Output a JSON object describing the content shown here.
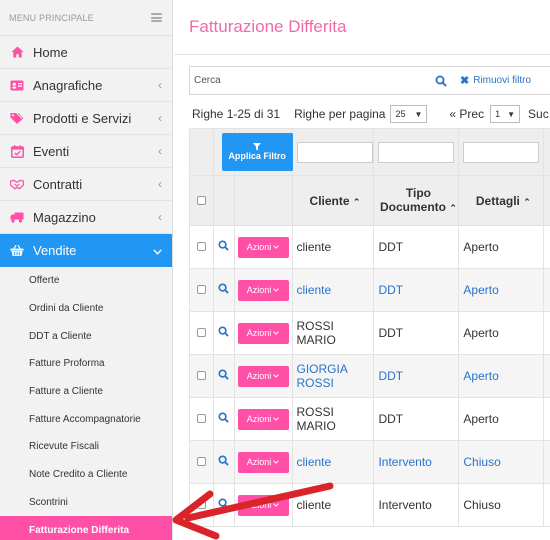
{
  "sidebar": {
    "title": "MENU PRINCIPALE",
    "items": [
      {
        "label": "Home",
        "icon": "home-icon",
        "has_chevron": false
      },
      {
        "label": "Anagrafiche",
        "icon": "id-card-icon",
        "has_chevron": true
      },
      {
        "label": "Prodotti e Servizi",
        "icon": "tags-icon",
        "has_chevron": true
      },
      {
        "label": "Eventi",
        "icon": "calendar-check-icon",
        "has_chevron": true
      },
      {
        "label": "Contratti",
        "icon": "handshake-icon",
        "has_chevron": true
      },
      {
        "label": "Magazzino",
        "icon": "truck-icon",
        "has_chevron": true
      },
      {
        "label": "Vendite",
        "icon": "basket-icon",
        "has_chevron": true,
        "active": true
      }
    ],
    "sub_items": [
      "Offerte",
      "Ordini da Cliente",
      "DDT a Cliente",
      "Fatture Proforma",
      "Fatture a Cliente",
      "Fatture Accompagnatorie",
      "Ricevute Fiscali",
      "Note Credito a Cliente",
      "Scontrini",
      "Fatturazione Differita"
    ],
    "active_sub_item": "Fatturazione Differita"
  },
  "main": {
    "title": "Fatturazione Differita",
    "search": {
      "placeholder": "Cerca",
      "remove_filters_label": "Rimuovi filtro"
    },
    "pager": {
      "rows_info": "Righe 1-25 di 31",
      "rows_per_page_label": "Righe per pagina",
      "rows_per_page_value": "25",
      "prev_label": "« Prec",
      "page_value": "1",
      "next_label": "Suc"
    },
    "apply_filter_label": "Applica Filtro",
    "columns": {
      "cliente": "Cliente",
      "tipo_documento": "Tipo Documento",
      "dettagli": "Dettagli"
    },
    "actions_label": "Azioni",
    "rows": [
      {
        "cliente": "cliente",
        "tipo": "DDT",
        "dettagli": "Aperto",
        "link": false
      },
      {
        "cliente": "cliente",
        "tipo": "DDT",
        "dettagli": "Aperto",
        "link": true
      },
      {
        "cliente": "ROSSI MARIO",
        "tipo": "DDT",
        "dettagli": "Aperto",
        "link": false
      },
      {
        "cliente": "GIORGIA ROSSI",
        "tipo": "DDT",
        "dettagli": "Aperto",
        "link": true
      },
      {
        "cliente": "ROSSI MARIO",
        "tipo": "DDT",
        "dettagli": "Aperto",
        "link": false
      },
      {
        "cliente": "cliente",
        "tipo": "Intervento",
        "dettagli": "Chiuso",
        "link": true
      },
      {
        "cliente": "cliente",
        "tipo": "Intervento",
        "dettagli": "Chiuso",
        "link": false
      }
    ]
  },
  "colors": {
    "accent_pink": "#ff4fa7",
    "title_pink": "#f06aa8",
    "primary_blue": "#2196f3",
    "link_blue": "#2a73c9",
    "arrow_red": "#d9252a"
  }
}
